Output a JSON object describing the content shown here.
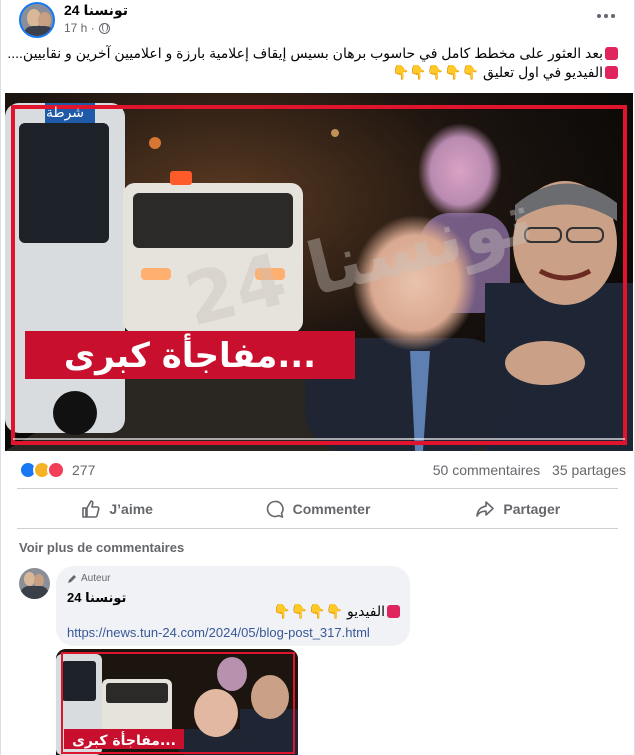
{
  "post": {
    "page_name": "تونسنا 24",
    "time": "17 h ·",
    "text_line1": "بعد العثور على مخطط كامل في حاسوب برهان بسيس إيقاف إعلامية بارزة و اعلاميين آخرين و نقابيين....",
    "text_line2": "الفيديو في اول تعليق",
    "text_line2_emojis": "👇👇👇👇👇"
  },
  "image": {
    "headline": "مفاجأة كبرى...",
    "watermark": "تونسنا 24",
    "police_sign": "شرطة"
  },
  "reactions": {
    "count": "277",
    "comments": "50 commentaires",
    "shares": "35 partages"
  },
  "actions": {
    "like": "J’aime",
    "comment": "Commenter",
    "share": "Partager"
  },
  "more_comments": "Voir plus de commentaires",
  "comment": {
    "badge": "Auteur",
    "author": "تونسنا 24",
    "text": "الفيديو",
    "emojis": "👇👇👇👇",
    "link": "https://news.tun-24.com/2024/05/blog-post_317.html"
  },
  "colors": {
    "brand_blue": "#1877f2",
    "headline_red": "#c8102e",
    "frame_red": "#e0142c",
    "link": "#385898"
  }
}
